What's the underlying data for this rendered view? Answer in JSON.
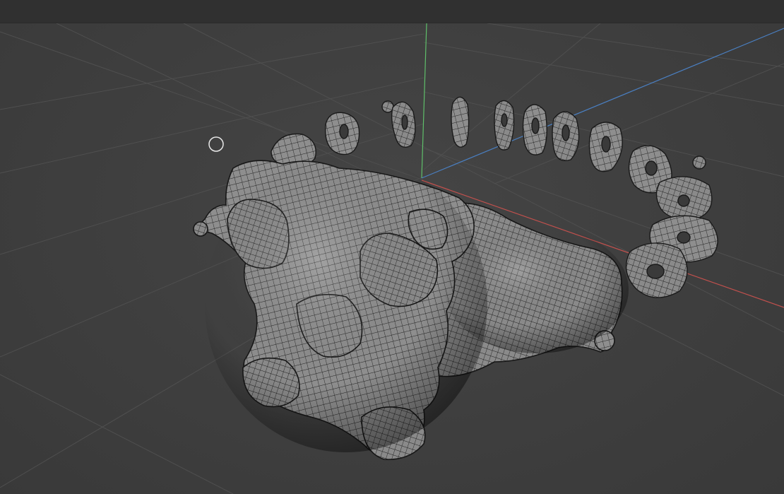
{
  "viewport": {
    "mode": "3d-viewport",
    "shading": "solid-wireframe",
    "cursor_icon": "brush-circle-cursor-icon",
    "axes": {
      "x_color": "#c0504d",
      "y_color": "#4a7fc1",
      "z_color": "#5fbf6a"
    },
    "grid_color": "#4e4e4e",
    "background_color": "#3d3d3d",
    "mesh_color": "#8d8d8d",
    "wire_color": "#1e1e1e"
  }
}
